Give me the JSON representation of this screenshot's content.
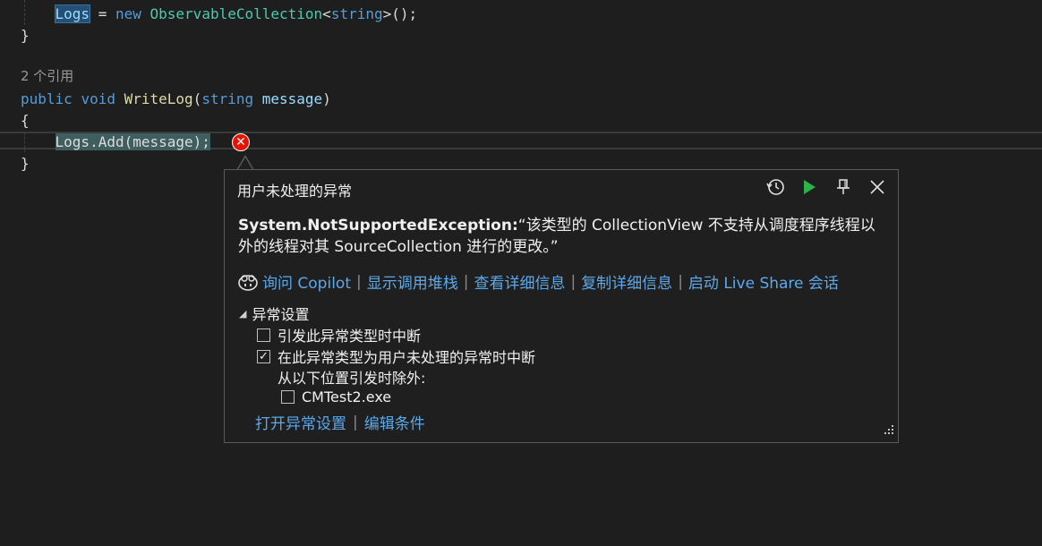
{
  "code": {
    "line1_ident": "Logs",
    "line1_op": " = ",
    "line1_new": "new",
    "line1_type": "ObservableCollection",
    "line1_generic_open": "<",
    "line1_generic_type": "string",
    "line1_tail": ">();",
    "line2": "}",
    "codelens": "2 个引用",
    "sig_public": "public",
    "sig_void": "void",
    "sig_name": "WriteLog",
    "sig_open": "(",
    "sig_ptype": "string",
    "sig_pname": "message",
    "sig_close": ")",
    "open_brace": "{",
    "current_stmt": "Logs.Add(message);",
    "close_brace": "}"
  },
  "popup": {
    "title": "用户未处理的异常",
    "exception_type": "System.NotSupportedException:",
    "exception_message": "“该类型的 CollectionView 不支持从调度程序线程以外的线程对其 SourceCollection 进行的更改。”",
    "links": {
      "ask_copilot": "询问 Copilot",
      "show_call_stack": "显示调用堆栈",
      "view_details": "查看详细信息",
      "copy_details": "复制详细信息",
      "live_share": "启动 Live Share 会话"
    },
    "settings": {
      "header": "异常设置",
      "break_when_thrown": "引发此异常类型时中断",
      "break_when_thrown_checked": false,
      "break_when_unhandled": "在此异常类型为用户未处理的异常时中断",
      "break_when_unhandled_checked": true,
      "except_label": "从以下位置引发时除外:",
      "exe_name": "CMTest2.exe",
      "exe_checked": false
    },
    "bottom_links": {
      "open_settings": "打开异常设置",
      "edit_conditions": "编辑条件"
    }
  },
  "icons": {
    "error": "error-x-icon",
    "history": "history-icon",
    "continue": "play-icon",
    "pin": "pin-icon",
    "close": "close-icon",
    "copilot": "copilot-icon"
  },
  "colors": {
    "background": "#1e1e1e",
    "link": "#5ca8ea",
    "error": "#e51400",
    "continue_green": "#2bb34a"
  }
}
